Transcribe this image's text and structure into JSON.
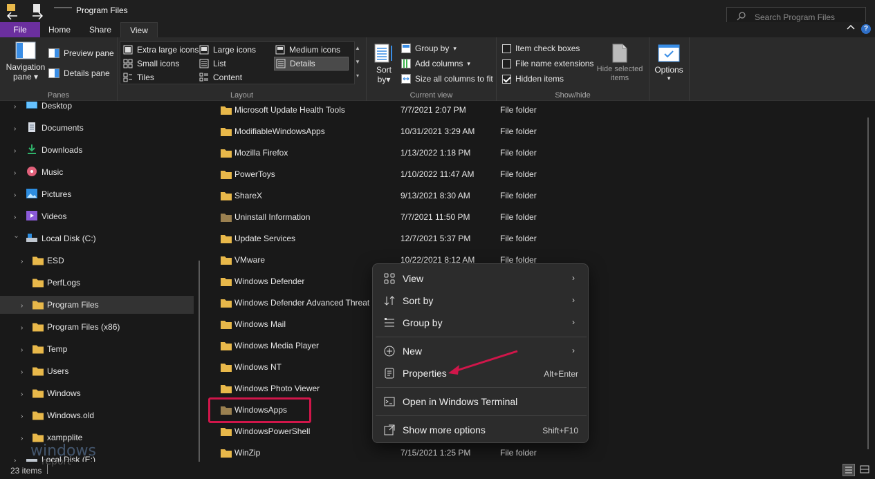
{
  "window": {
    "title": "Program Files",
    "search_placeholder": "Search Program Files"
  },
  "tabs": [
    "File",
    "Home",
    "Share",
    "View"
  ],
  "ribbon": {
    "panes": {
      "label": "Panes",
      "navigation_pane": "Navigation\npane",
      "navigation_pane_line1": "Navigation",
      "navigation_pane_line2": "pane",
      "preview_pane": "Preview pane",
      "details_pane": "Details pane"
    },
    "layout": {
      "label": "Layout",
      "items": [
        "Extra large icons",
        "Large icons",
        "Medium icons",
        "Small icons",
        "List",
        "Details",
        "Tiles",
        "Content"
      ],
      "selected": "Details"
    },
    "current_view": {
      "label": "Current view",
      "sort_line1": "Sort",
      "sort_line2": "by",
      "group_by": "Group by",
      "add_columns": "Add columns",
      "size_all_columns": "Size all columns to fit"
    },
    "show_hide": {
      "label": "Show/hide",
      "item_check_boxes": "Item check boxes",
      "item_check_boxes_checked": false,
      "file_name_extensions": "File name extensions",
      "file_name_extensions_checked": false,
      "hidden_items": "Hidden items",
      "hidden_items_checked": true,
      "hide_selected_line1": "Hide selected",
      "hide_selected_line2": "items"
    },
    "options": {
      "label": "Options"
    }
  },
  "nav": {
    "items": [
      {
        "label": "Desktop",
        "icon": "desktop-icon",
        "level": 0
      },
      {
        "label": "Documents",
        "icon": "documents-icon",
        "level": 0
      },
      {
        "label": "Downloads",
        "icon": "downloads-icon",
        "level": 0
      },
      {
        "label": "Music",
        "icon": "music-icon",
        "level": 0
      },
      {
        "label": "Pictures",
        "icon": "pictures-icon",
        "level": 0
      },
      {
        "label": "Videos",
        "icon": "videos-icon",
        "level": 0
      },
      {
        "label": "Local Disk (C:)",
        "icon": "drive-icon",
        "level": 0,
        "expanded": true
      },
      {
        "label": "ESD",
        "icon": "folder-icon",
        "level": 1
      },
      {
        "label": "PerfLogs",
        "icon": "folder-icon",
        "level": 1
      },
      {
        "label": "Program Files",
        "icon": "folder-icon",
        "level": 1,
        "selected": true
      },
      {
        "label": "Program Files (x86)",
        "icon": "folder-icon",
        "level": 1
      },
      {
        "label": "Temp",
        "icon": "folder-icon",
        "level": 1
      },
      {
        "label": "Users",
        "icon": "folder-icon",
        "level": 1
      },
      {
        "label": "Windows",
        "icon": "folder-icon",
        "level": 1
      },
      {
        "label": "Windows.old",
        "icon": "folder-icon",
        "level": 1
      },
      {
        "label": "xampplite",
        "icon": "folder-icon",
        "level": 1
      },
      {
        "label": "Local Disk (E:)",
        "icon": "drive-icon",
        "level": 0
      }
    ]
  },
  "files": [
    {
      "name": "Microsoft Update Health Tools",
      "date": "7/7/2021 2:07 PM",
      "type": "File folder"
    },
    {
      "name": "ModifiableWindowsApps",
      "date": "10/31/2021 3:29 AM",
      "type": "File folder"
    },
    {
      "name": "Mozilla Firefox",
      "date": "1/13/2022 1:18 PM",
      "type": "File folder"
    },
    {
      "name": "PowerToys",
      "date": "1/10/2022 11:47 AM",
      "type": "File folder"
    },
    {
      "name": "ShareX",
      "date": "9/13/2021 8:30 AM",
      "type": "File folder"
    },
    {
      "name": "Uninstall Information",
      "date": "7/7/2021 11:50 PM",
      "type": "File folder"
    },
    {
      "name": "Update Services",
      "date": "12/7/2021 5:37 PM",
      "type": "File folder"
    },
    {
      "name": "VMware",
      "date": "10/22/2021 8:12 AM",
      "type": "File folder"
    },
    {
      "name": "Windows Defender",
      "date": "",
      "type": ""
    },
    {
      "name": "Windows Defender Advanced Threat P",
      "date": "",
      "type": ""
    },
    {
      "name": "Windows Mail",
      "date": "",
      "type": ""
    },
    {
      "name": "Windows Media Player",
      "date": "",
      "type": ""
    },
    {
      "name": "Windows NT",
      "date": "",
      "type": ""
    },
    {
      "name": "Windows Photo Viewer",
      "date": "",
      "type": ""
    },
    {
      "name": "WindowsApps",
      "date": "",
      "type": ""
    },
    {
      "name": "WindowsPowerShell",
      "date": "",
      "type": ""
    },
    {
      "name": "WinZip",
      "date": "7/15/2021 1:25 PM",
      "type": "File folder"
    }
  ],
  "context_menu": {
    "view": "View",
    "sort_by": "Sort by",
    "group_by": "Group by",
    "new": "New",
    "properties": "Properties",
    "properties_shortcut": "Alt+Enter",
    "terminal": "Open in Windows Terminal",
    "more_options": "Show more options",
    "more_options_shortcut": "Shift+F10"
  },
  "status": {
    "item_count": "23 items"
  },
  "watermark": {
    "line1": "windows",
    "line2": "report"
  },
  "colors": {
    "accent_file_tab": "#6b2f9e",
    "highlight_box": "#d0164a",
    "annotation_arrow": "#d0164a",
    "folder": "#e8b84a"
  }
}
